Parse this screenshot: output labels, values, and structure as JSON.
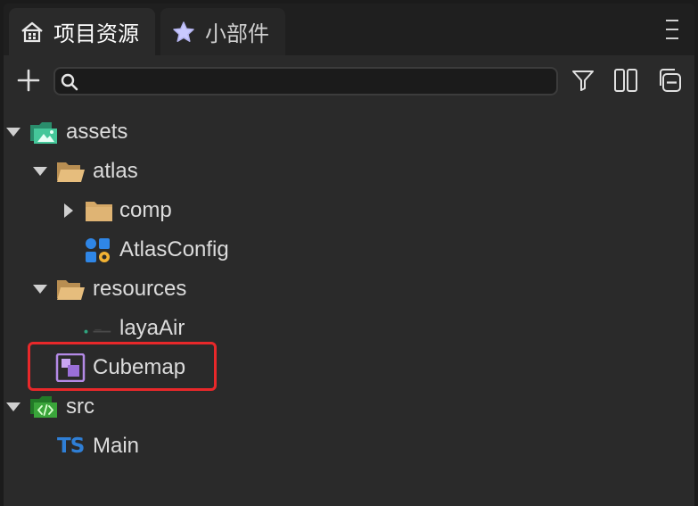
{
  "tabs": [
    {
      "label": "项目资源",
      "icon": "home-icon",
      "active": true
    },
    {
      "label": "小部件",
      "icon": "star-icon",
      "active": false
    }
  ],
  "toolbar": {
    "add_icon": "plus-icon",
    "search_placeholder": "",
    "search_value": "",
    "filter_icon": "filter-icon",
    "split_icon": "columns-icon",
    "collapse_icon": "collapse-all-icon"
  },
  "tree": [
    {
      "label": "assets",
      "type": "assets-folder",
      "expanded": true
    },
    {
      "label": "atlas",
      "type": "folder-open",
      "expanded": true
    },
    {
      "label": "comp",
      "type": "folder",
      "expanded": false
    },
    {
      "label": "AtlasConfig",
      "type": "atlas-config"
    },
    {
      "label": "resources",
      "type": "folder-open",
      "expanded": true
    },
    {
      "label": "layaAir",
      "type": "image"
    },
    {
      "label": "Cubemap",
      "type": "cubemap",
      "highlighted": true
    },
    {
      "label": "src",
      "type": "src-folder",
      "expanded": true
    },
    {
      "label": "Main",
      "type": "typescript",
      "badge": "TS"
    }
  ],
  "colors": {
    "highlight": "#e8282a",
    "folder": "#d9b071",
    "assets_folder": "#3fb68b",
    "src_folder": "#3aa53a",
    "typescript": "#2f7fd6",
    "cubemap": "#b48ae6"
  }
}
